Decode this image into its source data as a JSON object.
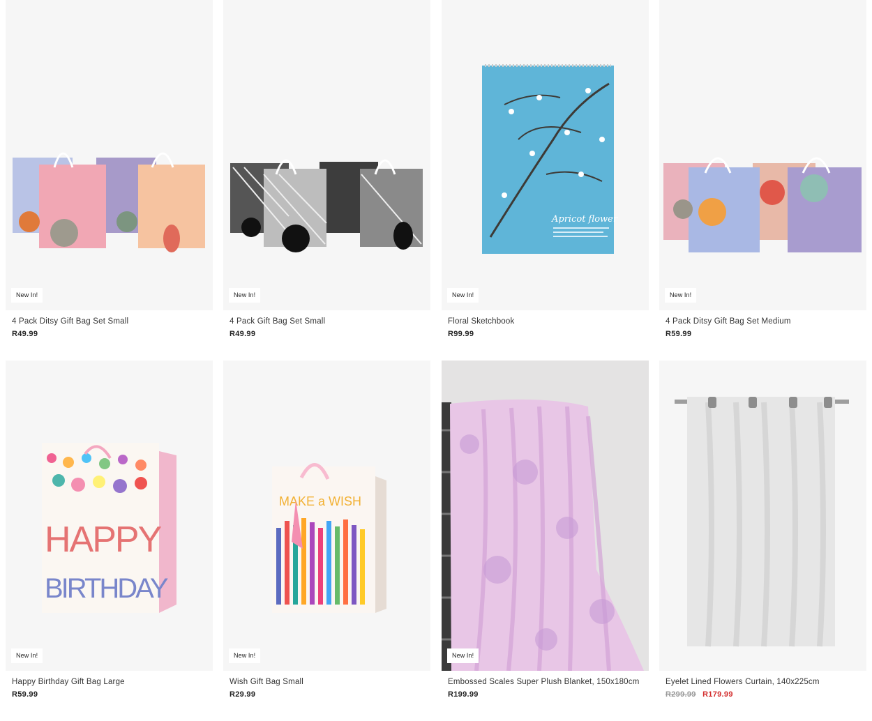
{
  "products": [
    {
      "name": "4 Pack Ditsy Gift Bag Set Small",
      "badge": "New In!",
      "price": "R49.99"
    },
    {
      "name": "4 Pack Gift Bag Set Small",
      "badge": "New In!",
      "price": "R49.99"
    },
    {
      "name": "Floral Sketchbook",
      "badge": "New In!",
      "price": "R99.99"
    },
    {
      "name": "4 Pack Ditsy Gift Bag Set Medium",
      "badge": "New In!",
      "price": "R59.99"
    },
    {
      "name": "Happy Birthday Gift Bag Large",
      "badge": "New In!",
      "price": "R59.99"
    },
    {
      "name": "Wish Gift Bag Small",
      "badge": "New In!",
      "price": "R29.99"
    },
    {
      "name": "Embossed Scales Super Plush Blanket, 150x180cm",
      "badge": "New In!",
      "price": "R199.99"
    },
    {
      "name": "Eyelet Lined Flowers Curtain, 140x225cm",
      "old_price": "R299.99",
      "price": "R179.99"
    }
  ],
  "image_text": {
    "sketchbook_cover": "Apricot flower",
    "birthday_bag_line1": "HAPPY",
    "birthday_bag_line2": "BIRTHDAY",
    "wish_bag": "MAKE a WISH"
  },
  "colors": {
    "sale_price": "#d32f2f",
    "old_price": "#999999",
    "card_bg": "#f6f6f6"
  }
}
